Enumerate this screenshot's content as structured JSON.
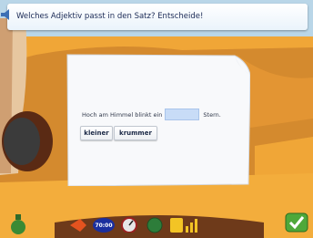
{
  "question": {
    "text": "Welches Adjektiv passt in den Satz? Entscheide!"
  },
  "exercise": {
    "sentence_before": "Hoch am Himmel blinkt ein",
    "sentence_after": "Stern.",
    "blank_value": "",
    "choices": [
      "kleiner",
      "krummer"
    ]
  },
  "toolbar": {
    "clock_display": "70:00"
  },
  "colors": {
    "sky_band": "#b9d6e8",
    "wall": "#f0a637",
    "floor": "#d48a2e",
    "paper": "#f8f9fb",
    "blank": "#c8dcf7",
    "check_button": "#4ea83a"
  }
}
